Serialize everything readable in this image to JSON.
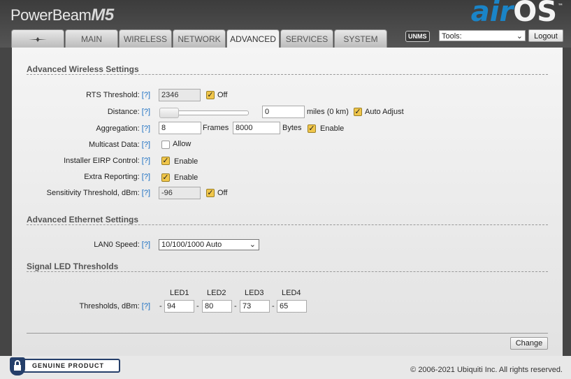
{
  "header": {
    "brand": "PowerBeam",
    "brand_model": "M5",
    "logo_air": "air",
    "logo_os": "OS",
    "logo_tm": "™"
  },
  "tabs": [
    {
      "label": "",
      "icon": "ubiquiti-logo-icon"
    },
    {
      "label": "MAIN"
    },
    {
      "label": "WIRELESS"
    },
    {
      "label": "NETWORK"
    },
    {
      "label": "ADVANCED",
      "active": true
    },
    {
      "label": "SERVICES"
    },
    {
      "label": "SYSTEM"
    }
  ],
  "topright": {
    "unms_label": "UNMS",
    "tools_value": "Tools:",
    "logout_label": "Logout"
  },
  "advanced_wireless": {
    "title": "Advanced Wireless Settings",
    "help": "[?]",
    "rts": {
      "label": "RTS Threshold:",
      "value": "2346",
      "checkbox_label": "Off",
      "checked": true
    },
    "distance": {
      "label": "Distance:",
      "value": "0",
      "unit": "miles (0 km)",
      "auto_label": "Auto Adjust",
      "auto_checked": true
    },
    "aggregation": {
      "label": "Aggregation:",
      "frames_value": "8",
      "frames_label": "Frames",
      "bytes_value": "8000",
      "bytes_label": "Bytes",
      "enable_label": "Enable",
      "checked": true
    },
    "multicast": {
      "label": "Multicast Data:",
      "checkbox_label": "Allow",
      "checked": false
    },
    "eirp": {
      "label": "Installer EIRP Control:",
      "checkbox_label": "Enable",
      "checked": true
    },
    "extra": {
      "label": "Extra Reporting:",
      "checkbox_label": "Enable",
      "checked": true
    },
    "sensitivity": {
      "label": "Sensitivity Threshold, dBm:",
      "value": "-96",
      "checkbox_label": "Off",
      "checked": true
    }
  },
  "advanced_ethernet": {
    "title": "Advanced Ethernet Settings",
    "lan0": {
      "label": "LAN0 Speed:",
      "value": "10/100/1000 Auto"
    }
  },
  "led": {
    "title": "Signal LED Thresholds",
    "headers": [
      "LED1",
      "LED2",
      "LED3",
      "LED4"
    ],
    "label": "Thresholds, dBm:",
    "dash": "-",
    "values": [
      "94",
      "80",
      "73",
      "65"
    ]
  },
  "actions": {
    "change_label": "Change"
  },
  "footer": {
    "copyright": "© 2006-2021 Ubiquiti Inc. All rights reserved.",
    "badge": "GENUINE PRODUCT"
  },
  "colors": {
    "checkbox_checked": "#f0c64b",
    "help_link": "#1b6fc2",
    "logo_air": "#1a84c7"
  }
}
